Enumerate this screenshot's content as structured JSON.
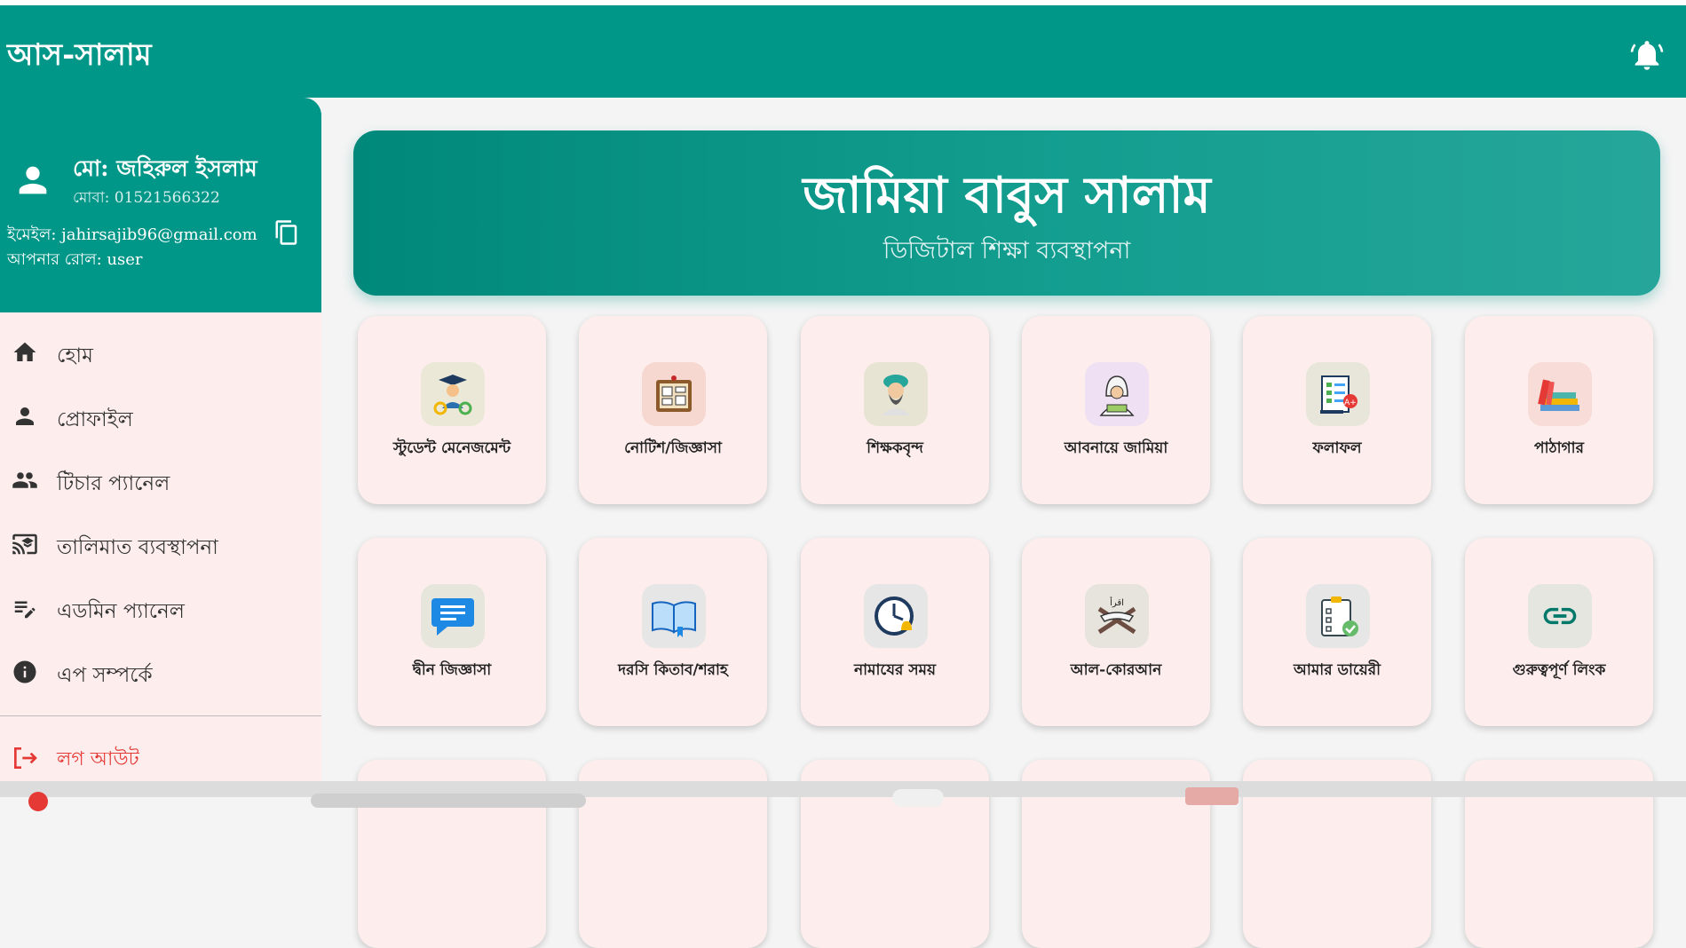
{
  "app": {
    "title": "আস-সালাম"
  },
  "user": {
    "name": "মো: জহিরুল ইসলাম",
    "phone": "মোবা: 01521566322",
    "email": "ইমেইল: jahirsajib96@gmail.com",
    "role": "আপনার রোল: user"
  },
  "nav": {
    "items": [
      {
        "label": "হোম",
        "icon": "home-icon"
      },
      {
        "label": "প্রোফাইল",
        "icon": "person-icon"
      },
      {
        "label": "টিচার প্যানেল",
        "icon": "people-icon"
      },
      {
        "label": "তালিমাত ব্যবস্থাপনা",
        "icon": "cast-for-education-icon"
      },
      {
        "label": "এডমিন প্যানেল",
        "icon": "edit-note-icon"
      },
      {
        "label": "এপ সম্পর্কে",
        "icon": "info-icon"
      }
    ],
    "logout": "লগ আউট"
  },
  "banner": {
    "title": "জামিয়া বাবুস সালাম",
    "subtitle": "ডিজিটাল শিক্ষা ব্যবস্থাপনা"
  },
  "tiles": [
    {
      "label": "স্টুডেন্ট মেনেজমেন্ট",
      "icon": "student-management-icon"
    },
    {
      "label": "নোটিশ/জিজ্ঞাসা",
      "icon": "notice-board-icon"
    },
    {
      "label": "শিক্ষকবৃন্দ",
      "icon": "teacher-icon"
    },
    {
      "label": "আবনায়ে জামিয়া",
      "icon": "alumni-icon"
    },
    {
      "label": "ফলাফল",
      "icon": "result-icon"
    },
    {
      "label": "পাঠাগার",
      "icon": "library-books-icon"
    },
    {
      "label": "দ্বীন জিজ্ঞাসা",
      "icon": "chat-message-icon"
    },
    {
      "label": "দরসি কিতাব/শরাহ",
      "icon": "open-book-icon"
    },
    {
      "label": "নামাযের সময়",
      "icon": "prayer-clock-icon"
    },
    {
      "label": "আল-কোরআন",
      "icon": "quran-stand-icon"
    },
    {
      "label": "আমার ডায়েরী",
      "icon": "diary-clipboard-icon"
    },
    {
      "label": "গুরুত্বপূর্ণ লিংক",
      "icon": "link-icon"
    }
  ],
  "colors": {
    "primary": "#009688",
    "drawer_bg": "#fdeeed",
    "tile_bg": "#fdeeed",
    "logout": "#e53935"
  }
}
